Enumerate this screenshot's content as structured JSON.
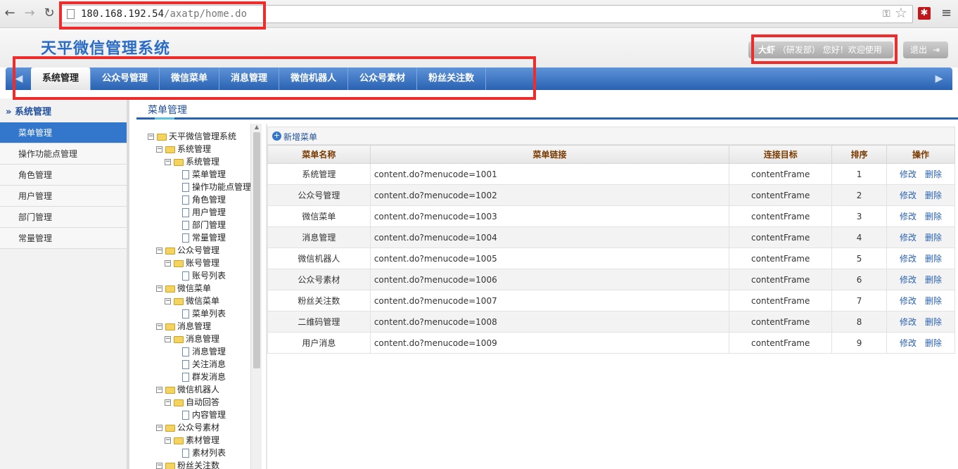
{
  "browser": {
    "url_host": "180.168.192.54",
    "url_path": "/axatp/home.do"
  },
  "app": {
    "title": "天平微信管理系统",
    "user_name": "大虾",
    "department": "（研发部）",
    "greeting": "您好！欢迎使用",
    "logout_label": "退出"
  },
  "tabs": [
    "系统管理",
    "公众号管理",
    "微信菜单",
    "消息管理",
    "微信机器人",
    "公众号素材",
    "粉丝关注数"
  ],
  "sidebar": {
    "heading": "系统管理",
    "items": [
      "菜单管理",
      "操作功能点管理",
      "角色管理",
      "用户管理",
      "部门管理",
      "常量管理"
    ]
  },
  "panel_title": "菜单管理",
  "tree": [
    {
      "label": "天平微信管理系统",
      "type": "folder"
    },
    {
      "label": "系统管理",
      "type": "folder"
    },
    {
      "label": "系统管理",
      "type": "folder"
    },
    {
      "label": "菜单管理",
      "type": "file"
    },
    {
      "label": "操作功能点管理",
      "type": "file"
    },
    {
      "label": "角色管理",
      "type": "file"
    },
    {
      "label": "用户管理",
      "type": "file"
    },
    {
      "label": "部门管理",
      "type": "file"
    },
    {
      "label": "常量管理",
      "type": "file"
    },
    {
      "label": "公众号管理",
      "type": "folder"
    },
    {
      "label": "账号管理",
      "type": "folder"
    },
    {
      "label": "账号列表",
      "type": "file"
    },
    {
      "label": "微信菜单",
      "type": "folder"
    },
    {
      "label": "微信菜单",
      "type": "folder"
    },
    {
      "label": "菜单列表",
      "type": "file"
    },
    {
      "label": "消息管理",
      "type": "folder"
    },
    {
      "label": "消息管理",
      "type": "folder"
    },
    {
      "label": "消息管理",
      "type": "file"
    },
    {
      "label": "关注消息",
      "type": "file"
    },
    {
      "label": "群发消息",
      "type": "file"
    },
    {
      "label": "微信机器人",
      "type": "folder"
    },
    {
      "label": "自动回答",
      "type": "folder"
    },
    {
      "label": "内容管理",
      "type": "file"
    },
    {
      "label": "公众号素材",
      "type": "folder"
    },
    {
      "label": "素材管理",
      "type": "folder"
    },
    {
      "label": "素材列表",
      "type": "file"
    },
    {
      "label": "粉丝关注数",
      "type": "folder"
    }
  ],
  "toolbar": {
    "add_label": "新增菜单"
  },
  "table": {
    "headers": [
      "菜单名称",
      "菜单链接",
      "连接目标",
      "排序",
      "操作"
    ],
    "edit_label": "修改",
    "delete_label": "删除",
    "rows": [
      [
        "系统管理",
        "content.do?menucode=1001",
        "contentFrame",
        "1"
      ],
      [
        "公众号管理",
        "content.do?menucode=1002",
        "contentFrame",
        "2"
      ],
      [
        "微信菜单",
        "content.do?menucode=1003",
        "contentFrame",
        "3"
      ],
      [
        "消息管理",
        "content.do?menucode=1004",
        "contentFrame",
        "4"
      ],
      [
        "微信机器人",
        "content.do?menucode=1005",
        "contentFrame",
        "5"
      ],
      [
        "公众号素材",
        "content.do?menucode=1006",
        "contentFrame",
        "6"
      ],
      [
        "粉丝关注数",
        "content.do?menucode=1007",
        "contentFrame",
        "7"
      ],
      [
        "二维码管理",
        "content.do?menucode=1008",
        "contentFrame",
        "8"
      ],
      [
        "用户消息",
        "content.do?menucode=1009",
        "contentFrame",
        "9"
      ]
    ]
  }
}
